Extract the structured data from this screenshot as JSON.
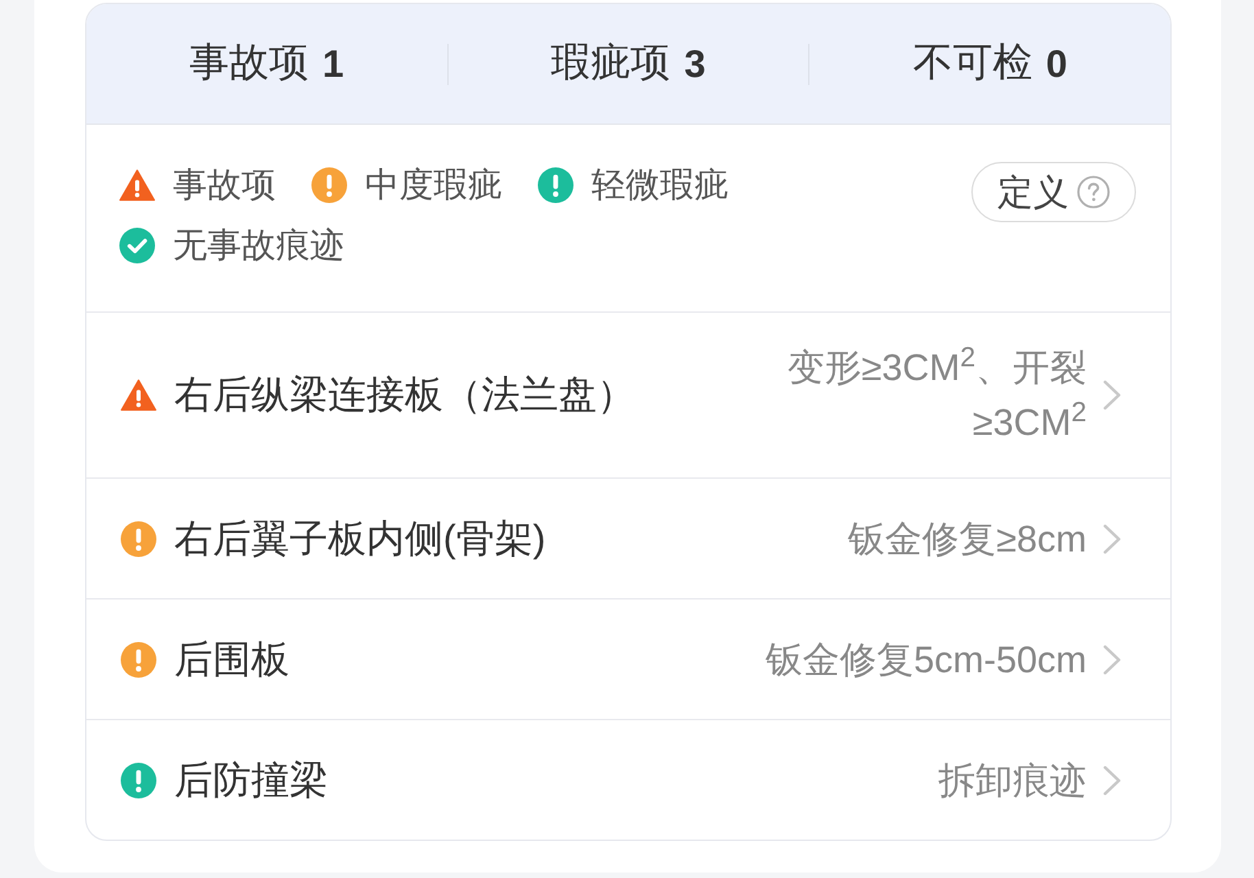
{
  "summary_tabs": [
    {
      "label": "事故项",
      "count": "1"
    },
    {
      "label": "瑕疵项",
      "count": "3"
    },
    {
      "label": "不可检",
      "count": "0"
    }
  ],
  "legend": [
    {
      "kind": "accident",
      "label": "事故项"
    },
    {
      "kind": "moderate",
      "label": "中度瑕疵"
    },
    {
      "kind": "minor",
      "label": "轻微瑕疵"
    },
    {
      "kind": "none",
      "label": "无事故痕迹"
    }
  ],
  "definition_button": {
    "label": "定义"
  },
  "items": [
    {
      "kind": "accident",
      "name": "右后纵梁连接板（法兰盘）",
      "detail": "变形≥3CM$^{2}$、开裂≥3CM$^{2}$"
    },
    {
      "kind": "moderate",
      "name": "右后翼子板内侧(骨架)",
      "detail": "钣金修复≥8cm"
    },
    {
      "kind": "moderate",
      "name": "后围板",
      "detail": "钣金修复5cm-50cm"
    },
    {
      "kind": "minor",
      "name": "后防撞梁",
      "detail": "拆卸痕迹"
    }
  ]
}
